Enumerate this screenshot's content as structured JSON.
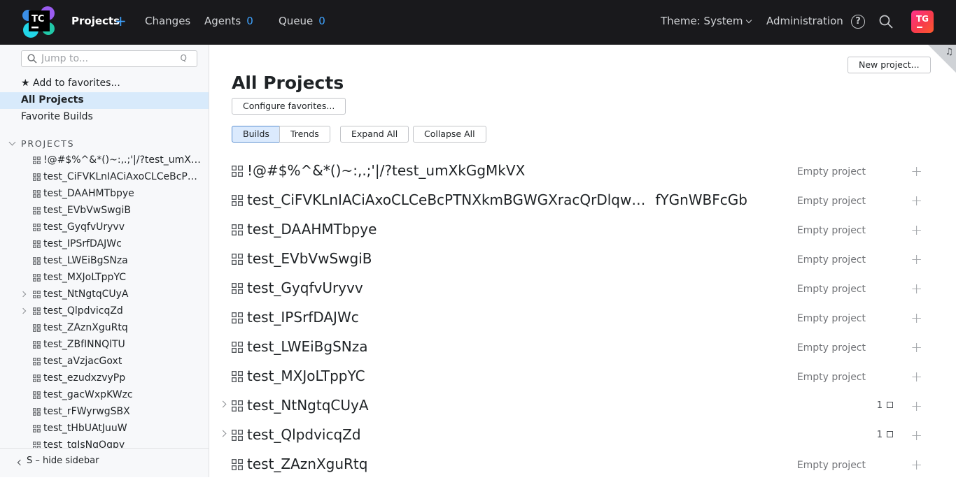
{
  "topbar": {
    "logo_text": "TC",
    "nav": {
      "projects": "Projects",
      "changes": "Changes",
      "agents": "Agents",
      "agents_count": "0",
      "queue": "Queue",
      "queue_count": "0"
    },
    "theme": "Theme: System",
    "administration": "Administration",
    "help_glyph": "?",
    "avatar_initials": "TG"
  },
  "sidebar": {
    "jump_placeholder": "Jump to...",
    "jump_shortcut": "Q",
    "add_favorites": "★ Add to favorites...",
    "all_projects": "All Projects",
    "favorite_builds": "Favorite Builds",
    "section_title": "PROJECTS",
    "tree": [
      {
        "label": "!@#$%^&*()~:,.;'|/?test_umXkGgMkVX",
        "expandable": false
      },
      {
        "label": "test_CiFVKLnIACiAxoCLCeBcPTNXkmBGWGXracQrDlqwfYGnWBFcGb",
        "expandable": false
      },
      {
        "label": "test_DAAHMTbpye",
        "expandable": false
      },
      {
        "label": "test_EVbVwSwgiB",
        "expandable": false
      },
      {
        "label": "test_GyqfvUryvv",
        "expandable": false
      },
      {
        "label": "test_IPSrfDAJWc",
        "expandable": false
      },
      {
        "label": "test_LWEiBgSNza",
        "expandable": false
      },
      {
        "label": "test_MXJoLTppYC",
        "expandable": false
      },
      {
        "label": "test_NtNgtqCUyA",
        "expandable": true
      },
      {
        "label": "test_QlpdvicqZd",
        "expandable": true
      },
      {
        "label": "test_ZAznXguRtq",
        "expandable": false
      },
      {
        "label": "test_ZBfINNQlTU",
        "expandable": false
      },
      {
        "label": "test_aVzjacGoxt",
        "expandable": false
      },
      {
        "label": "test_ezudxzvyPp",
        "expandable": false
      },
      {
        "label": "test_gacWxpKWzc",
        "expandable": false
      },
      {
        "label": "test_rFWyrwgSBX",
        "expandable": false
      },
      {
        "label": "test_tHbUAtJuuW",
        "expandable": false
      },
      {
        "label": "test_tqIsNqOqpy",
        "expandable": false
      }
    ],
    "hide_sidebar": "S – hide sidebar"
  },
  "main": {
    "title": "All Projects",
    "new_project": "New project...",
    "configure_favorites": "Configure favorites...",
    "tabs": {
      "builds": "Builds",
      "trends": "Trends"
    },
    "expand_all": "Expand All",
    "collapse_all": "Collapse All",
    "projects": [
      {
        "name": "!@#$%^&*()~:,.;'|/?test_umXkGgMkVX",
        "tail": "",
        "status": "Empty project",
        "count": "",
        "expandable": false
      },
      {
        "name": "test_CiFVKLnIACiAxoCLCeBcPTNXkmBGWGXracQrDlqw…",
        "tail": "fYGnWBFcGb",
        "status": "Empty project",
        "count": "",
        "expandable": false
      },
      {
        "name": "test_DAAHMTbpye",
        "tail": "",
        "status": "Empty project",
        "count": "",
        "expandable": false
      },
      {
        "name": "test_EVbVwSwgiB",
        "tail": "",
        "status": "Empty project",
        "count": "",
        "expandable": false
      },
      {
        "name": "test_GyqfvUryvv",
        "tail": "",
        "status": "Empty project",
        "count": "",
        "expandable": false
      },
      {
        "name": "test_IPSrfDAJWc",
        "tail": "",
        "status": "Empty project",
        "count": "",
        "expandable": false
      },
      {
        "name": "test_LWEiBgSNza",
        "tail": "",
        "status": "Empty project",
        "count": "",
        "expandable": false
      },
      {
        "name": "test_MXJoLTppYC",
        "tail": "",
        "status": "Empty project",
        "count": "",
        "expandable": false
      },
      {
        "name": "test_NtNgtqCUyA",
        "tail": "",
        "status": "",
        "count": "1",
        "expandable": true
      },
      {
        "name": "test_QlpdvicqZd",
        "tail": "",
        "status": "",
        "count": "1",
        "expandable": true
      },
      {
        "name": "test_ZAznXguRtq",
        "tail": "",
        "status": "Empty project",
        "count": "",
        "expandable": false
      }
    ]
  },
  "colors": {
    "topbar_bg": "#19191c",
    "accent": "#3ea3ff",
    "sidebar_active": "#d8eafb",
    "avatar_gradient_start": "#ff318c",
    "avatar_gradient_end": "#fd5a2c"
  }
}
